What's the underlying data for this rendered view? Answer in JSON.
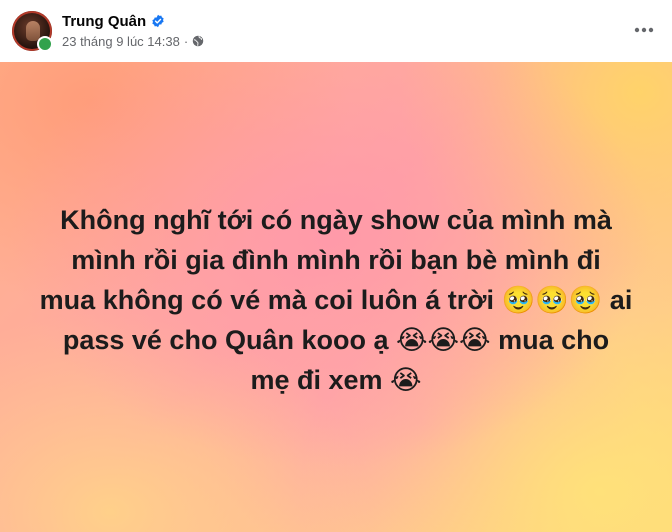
{
  "post": {
    "author": "Trung Quân",
    "timestamp": "23 tháng 9 lúc 14:38",
    "audience_icon": "globe-icon",
    "verified_icon": "verified-badge-icon",
    "more_icon": "more-dots-icon",
    "text_lines": [
      "Không nghĩ tới có ngày show của mình mà",
      "mình rồi gia đình mình rồi bạn bè mình đi",
      "mua không có vé mà coi luôn á trời 🥹🥹🥹 ai",
      "pass vé cho Quân kooo ạ 😭😭😭 mua cho",
      "mẹ đi xem 😭"
    ]
  },
  "colors": {
    "verified": "#1877f2",
    "online": "#31a24c",
    "meta_text": "#65676b"
  }
}
